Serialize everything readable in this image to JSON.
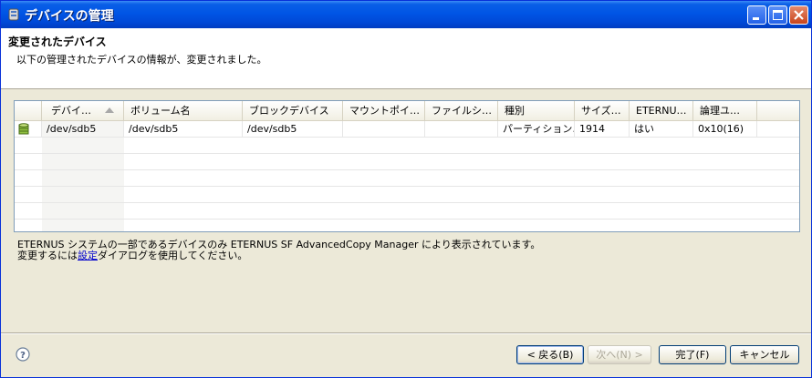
{
  "window": {
    "title": "デバイスの管理"
  },
  "header": {
    "title": "変更されたデバイス",
    "description": "以下の管理されたデバイスの情報が、変更されました。"
  },
  "table": {
    "columns": [
      "デバイ…",
      "ボリューム名",
      "ブロックデバイス",
      "マウントポイ…",
      "ファイルシ…",
      "種別",
      "サイズ…",
      "ETERNU…",
      "論理ユ…"
    ],
    "rows": [
      {
        "icon": "database-icon",
        "cells": [
          "/dev/sdb5",
          "/dev/sdb5",
          "/dev/sdb5",
          "",
          "",
          "パーティション…",
          "1914",
          "はい",
          "0x10(16)"
        ]
      }
    ]
  },
  "footnote": {
    "line1": "ETERNUS システムの一部であるデバイスのみ ETERNUS SF AdvancedCopy Manager により表示されています。",
    "line2_before": "変更するには",
    "line2_link": "設定",
    "line2_after": "ダイアログを使用してください。"
  },
  "buttons": {
    "back": "< 戻る(B)",
    "next": "次へ(N) >",
    "finish": "完了(F)",
    "cancel": "キャンセル"
  },
  "colors": {
    "titlebar": "#0055e5",
    "link": "#0000cc",
    "close_button": "#c8441c"
  }
}
